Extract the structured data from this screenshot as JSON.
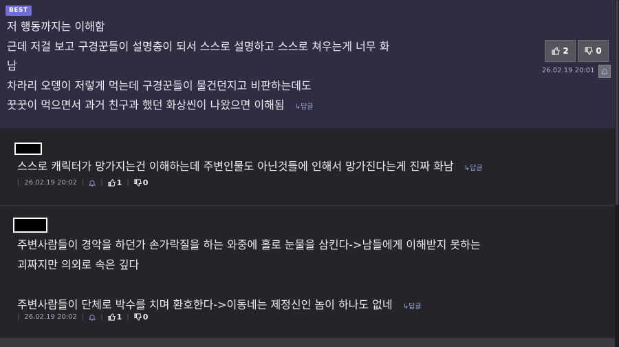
{
  "best": {
    "badge": "BEST",
    "lines": [
      "저 행동까지는 이해함",
      "근데 저걸 보고 구경꾼들이 설명충이 되서 스스로 설명하고 스스로 쳐우는게 너무 화",
      "남",
      "차라리 오뎅이 저렇게 먹는데 구경꾼들이 물건던지고 비판하는데도",
      "꿋꿋이 먹으면서 과거 친구과 했던 화상씬이 나왔으면 이해됨"
    ],
    "reply_label": "답글",
    "upvotes": "2",
    "downvotes": "0",
    "date": "26.02.19 20:01"
  },
  "comments": [
    {
      "lines": [
        "스스로 캐릭터가 망가지는건 이해하는데 주변인물도 아닌것들에 인해서 망가진다는게 진짜 화남"
      ],
      "reply_label": "답글",
      "date": "26.02.19 20:02",
      "upvotes": "1",
      "downvotes": "0"
    },
    {
      "lines": [
        "주변사람들이 경악을 하던가 손가락질을 하는 와중에 홀로 눈물을 삼킨다->남들에게 이해받지 못하는",
        "괴짜지만 의외로 속은 깊다",
        "",
        "주변사람들이 단체로 박수를 치며 환호한다->이동네는 제정신인 놈이 하나도 없네"
      ],
      "reply_label": "답글",
      "date": "26.02.19 20:02",
      "upvotes": "1",
      "downvotes": "0"
    }
  ],
  "colors": {
    "best_bg": "#302d42",
    "badge": "#6e6fd6",
    "reply_link": "#9aa6e6",
    "comment_bg": "#252428"
  },
  "icons": {
    "thumbs_up": "thumbs-up-icon",
    "thumbs_down": "thumbs-down-icon",
    "bell": "bell-icon",
    "reply_arrow": "reply-arrow-icon"
  }
}
